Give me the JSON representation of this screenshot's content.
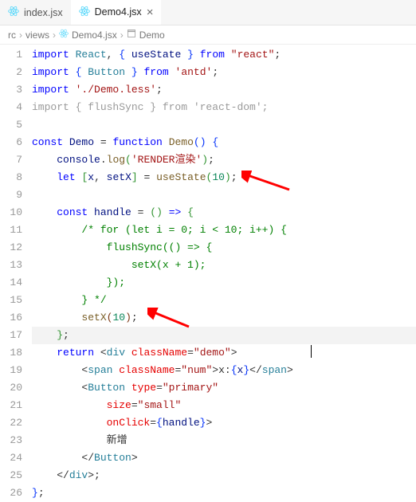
{
  "tabs": [
    {
      "label": "index.jsx",
      "active": false
    },
    {
      "label": "Demo4.jsx",
      "active": true
    }
  ],
  "breadcrumb": {
    "folder1": "rc",
    "folder2": "views",
    "file": "Demo4.jsx",
    "symbol": "Demo"
  },
  "code": {
    "l1": {
      "kw1": "import",
      "def": "React",
      "var": "useState",
      "kw2": "from",
      "str": "\"react\""
    },
    "l2": {
      "kw1": "import",
      "def": "Button",
      "kw2": "from",
      "str": "'antd'"
    },
    "l3": {
      "kw1": "import",
      "str": "'./Demo.less'"
    },
    "l4": {
      "text": "import { flushSync } from 'react-dom';"
    },
    "l6": {
      "kw1": "const",
      "var1": "Demo",
      "kw2": "function",
      "var2": "Demo"
    },
    "l7": {
      "obj": "console",
      "fn": "log",
      "str": "'RENDER渲染'"
    },
    "l8": {
      "kw": "let",
      "v1": "x",
      "v2": "setX",
      "fn": "useState",
      "num": "10"
    },
    "l10": {
      "kw": "const",
      "var": "handle"
    },
    "l11": {
      "text": "/* for (let i = 0; i < 10; i++) {"
    },
    "l12": {
      "text": "    flushSync(() => {"
    },
    "l13": {
      "text": "        setX(x + 1);"
    },
    "l14": {
      "text": "    });"
    },
    "l15": {
      "text": "} */"
    },
    "l16": {
      "fn": "setX",
      "num": "10"
    },
    "l18": {
      "kw": "return",
      "tag": "div",
      "attr": "className",
      "str": "\"demo\""
    },
    "l19": {
      "tag": "span",
      "attr": "className",
      "str": "\"num\"",
      "txt": "x:",
      "expr": "x",
      "tag2": "span"
    },
    "l20": {
      "tag": "Button",
      "attr": "type",
      "str": "\"primary\""
    },
    "l21": {
      "attr": "size",
      "str": "\"small\""
    },
    "l22": {
      "attr": "onClick",
      "expr": "handle"
    },
    "l23": {
      "txt": "新增"
    },
    "l24": {
      "tag": "Button"
    },
    "l25": {
      "tag": "div"
    }
  },
  "lines": [
    "1",
    "2",
    "3",
    "4",
    "5",
    "6",
    "7",
    "8",
    "9",
    "10",
    "11",
    "12",
    "13",
    "14",
    "15",
    "16",
    "17",
    "18",
    "19",
    "20",
    "21",
    "22",
    "23",
    "24",
    "25",
    "26"
  ]
}
